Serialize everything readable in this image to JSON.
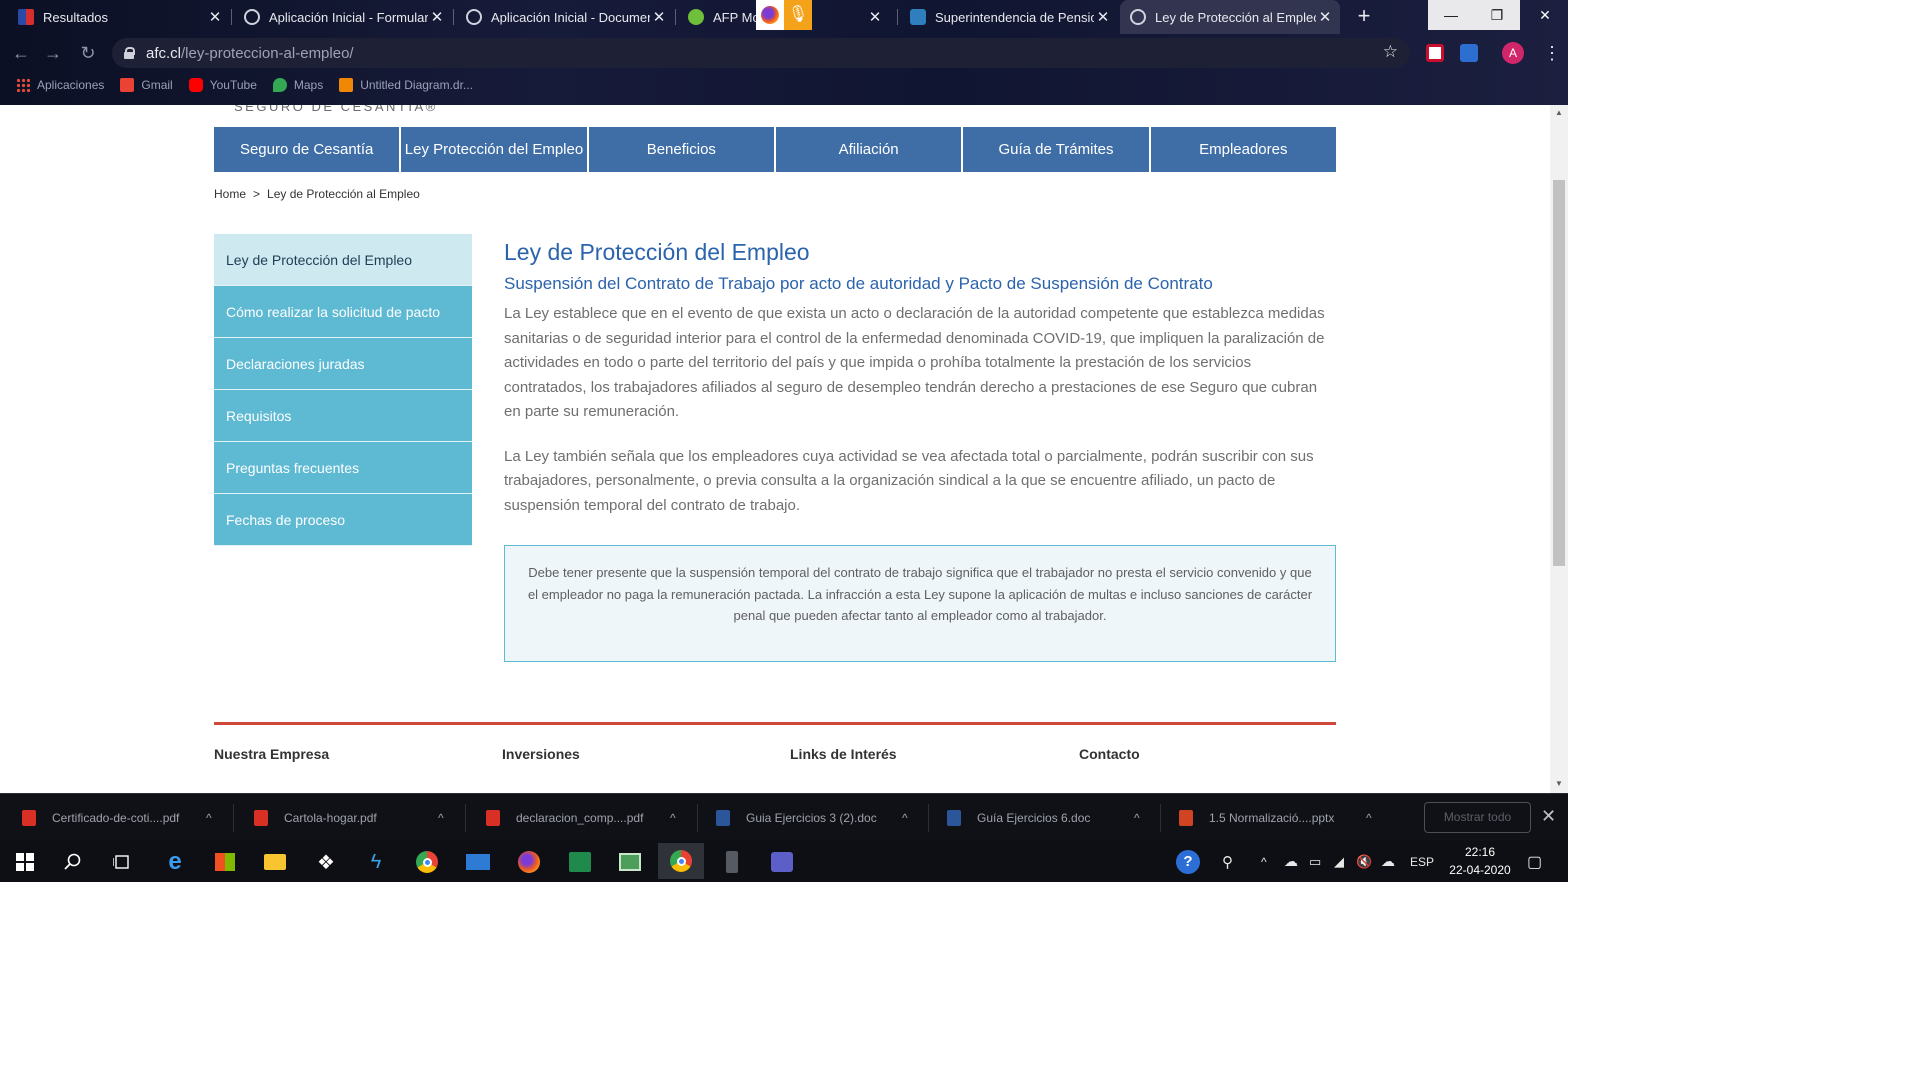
{
  "browser": {
    "tabs": [
      {
        "title": "Resultados"
      },
      {
        "title": "Aplicación Inicial - Formulario"
      },
      {
        "title": "Aplicación Inicial - Documentos"
      },
      {
        "title": "AFP Mo"
      },
      {
        "title": "Superintendencia de Pensiones"
      },
      {
        "title": "Ley de Protección al Empleo"
      }
    ],
    "new_tab": "+",
    "close_glyph": "✕",
    "url_domain": "afc.cl",
    "url_path": "/ley-proteccion-al-empleo/",
    "avatar_letter": "A",
    "bookmarks": [
      {
        "label": "Aplicaciones"
      },
      {
        "label": "Gmail"
      },
      {
        "label": "YouTube"
      },
      {
        "label": "Maps"
      },
      {
        "label": "Untitled Diagram.dr..."
      }
    ]
  },
  "site": {
    "logo_text": "SEGURO DE CESANTÍA®",
    "nav": [
      "Seguro de Cesantía",
      "Ley Protección del Empleo",
      "Beneficios",
      "Afiliación",
      "Guía de Trámites",
      "Empleadores"
    ],
    "breadcrumb": {
      "home": "Home",
      "sep": ">",
      "current": "Ley de Protección al Empleo"
    },
    "sidebar": [
      "Ley de Protección del Empleo",
      "Cómo realizar la solicitud de pacto",
      "Declaraciones juradas",
      "Requisitos",
      "Preguntas frecuentes",
      "Fechas de proceso"
    ],
    "content": {
      "title": "Ley de Protección del Empleo",
      "subtitle": "Suspensión del Contrato de Trabajo por acto de autoridad y Pacto de Suspensión de Contrato",
      "paragraph1": "La Ley establece que en el evento de que exista un acto o declaración de la autoridad competente que establezca medidas sanitarias o de seguridad interior para el control de la enfermedad denominada COVID-19, que impliquen la paralización de actividades en todo o parte del territorio del país y que impida o prohíba totalmente la prestación de los servicios contratados, los trabajadores afiliados al seguro de desempleo tendrán derecho a prestaciones de ese Seguro que cubran en parte su remuneración.",
      "paragraph2": "La Ley también señala que los empleadores cuya actividad se vea afectada total o parcialmente, podrán suscribir con sus trabajadores, personalmente, o previa consulta a la organización sindical a la que se encuentre afiliado, un pacto de suspensión temporal del contrato de trabajo.",
      "notice": "Debe tener presente que la suspensión temporal del contrato de trabajo significa que el trabajador no presta el servicio convenido y que el empleador no paga la remuneración pactada. La infracción a esta Ley supone la aplicación de multas e incluso sanciones de carácter penal que pueden afectar tanto al empleador como al trabajador."
    },
    "footer": [
      "Nuestra Empresa",
      "Inversiones",
      "Links de Interés",
      "Contacto"
    ]
  },
  "downloads": {
    "items": [
      {
        "name": "Certificado-de-coti....pdf",
        "type": "pdf"
      },
      {
        "name": "Cartola-hogar.pdf",
        "type": "pdf"
      },
      {
        "name": "declaracion_comp....pdf",
        "type": "pdf"
      },
      {
        "name": "Guia Ejercicios 3 (2).doc",
        "type": "doc"
      },
      {
        "name": "Guía Ejercicios 6.doc",
        "type": "doc"
      },
      {
        "name": "1.5 Normalizació....pptx",
        "type": "pptx"
      }
    ],
    "show_all": "Mostrar todo"
  },
  "taskbar": {
    "language": "ESP",
    "time": "22:16",
    "date": "22-04-2020"
  },
  "colors": {
    "nav_blue": "#3f6ea7",
    "sidebar_teal": "#5eb9d3",
    "sidebar_current": "#cfe9f1",
    "heading_blue": "#2b63ad",
    "footer_rule": "#d2473b"
  }
}
